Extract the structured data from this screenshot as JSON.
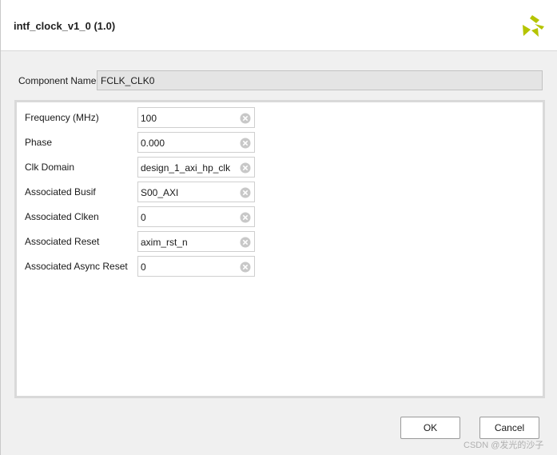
{
  "dialog": {
    "title": "intf_clock_v1_0 (1.0)",
    "logo_icon": "xilinx-logo-icon",
    "accent_color": "#b5c400"
  },
  "component": {
    "label": "Component Name",
    "value": "FCLK_CLK0"
  },
  "params": [
    {
      "label": "Frequency (MHz)",
      "value": "100"
    },
    {
      "label": "Phase",
      "value": "0.000"
    },
    {
      "label": "Clk Domain",
      "value": "design_1_axi_hp_clk"
    },
    {
      "label": "Associated Busif",
      "value": "S00_AXI"
    },
    {
      "label": "Associated Clken",
      "value": "0"
    },
    {
      "label": "Associated Reset",
      "value": "axim_rst_n"
    },
    {
      "label": "Associated Async Reset",
      "value": "0"
    }
  ],
  "buttons": {
    "ok": "OK",
    "cancel": "Cancel"
  },
  "watermark": "CSDN @发光的沙子"
}
